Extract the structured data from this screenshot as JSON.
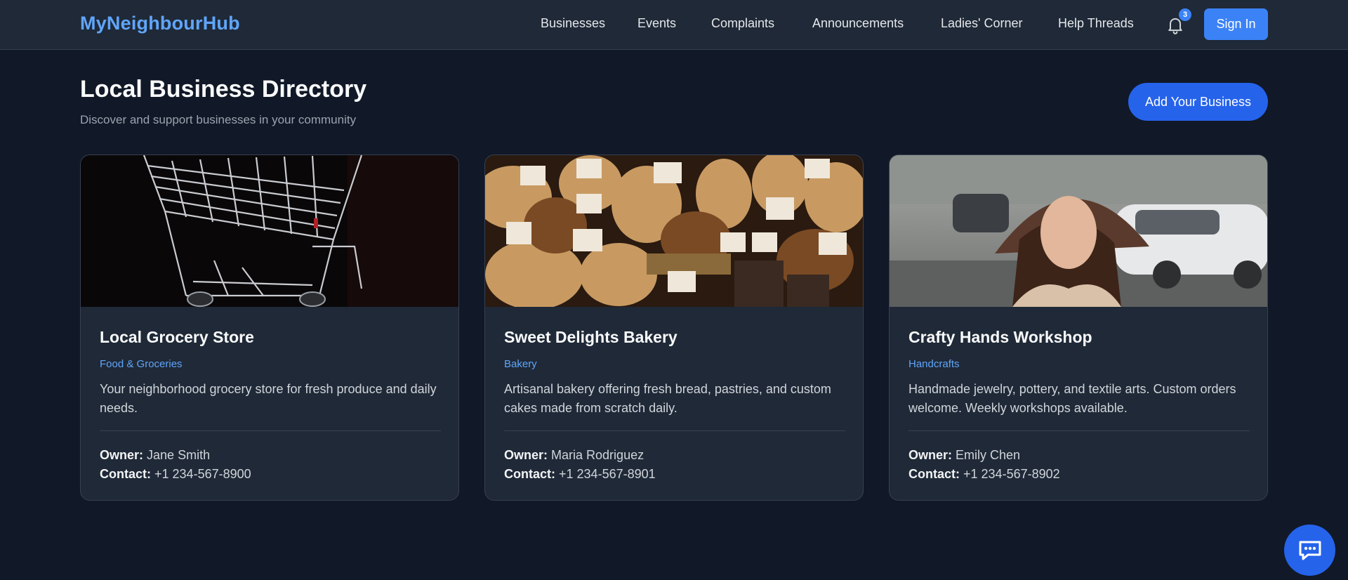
{
  "header": {
    "brand": "MyNeighbourHub",
    "nav": [
      "Businesses",
      "Events",
      "Complaints",
      "Announcements",
      "Ladies' Corner",
      "Help Threads"
    ],
    "notification_count": "3",
    "sign_in_label": "Sign In"
  },
  "page": {
    "title": "Local Business Directory",
    "subtitle": "Discover and support businesses in your community",
    "add_button_label": "Add Your Business"
  },
  "labels": {
    "owner": "Owner:",
    "contact": "Contact:"
  },
  "businesses": [
    {
      "name": "Local Grocery Store",
      "category": "Food & Groceries",
      "description": "Your neighborhood grocery store for fresh produce and daily needs.",
      "owner": "Jane Smith",
      "contact": "+1 234-567-8900",
      "image": "shopping-cart-photo"
    },
    {
      "name": "Sweet Delights Bakery",
      "category": "Bakery",
      "description": "Artisanal bakery offering fresh bread, pastries, and custom cakes made from scratch daily.",
      "owner": "Maria Rodriguez",
      "contact": "+1 234-567-8901",
      "image": "bread-loaves-photo"
    },
    {
      "name": "Crafty Hands Workshop",
      "category": "Handcrafts",
      "description": "Handmade jewelry, pottery, and textile arts. Custom orders welcome. Weekly workshops available.",
      "owner": "Emily Chen",
      "contact": "+1 234-567-8902",
      "image": "woman-in-hat-photo"
    }
  ],
  "icons": {
    "notifications": "bell-icon",
    "chat": "chat-bubble-icon"
  },
  "colors": {
    "accent": "#3b82f6",
    "brand": "#60a5fa",
    "background": "#111827",
    "surface": "#1f2937"
  }
}
